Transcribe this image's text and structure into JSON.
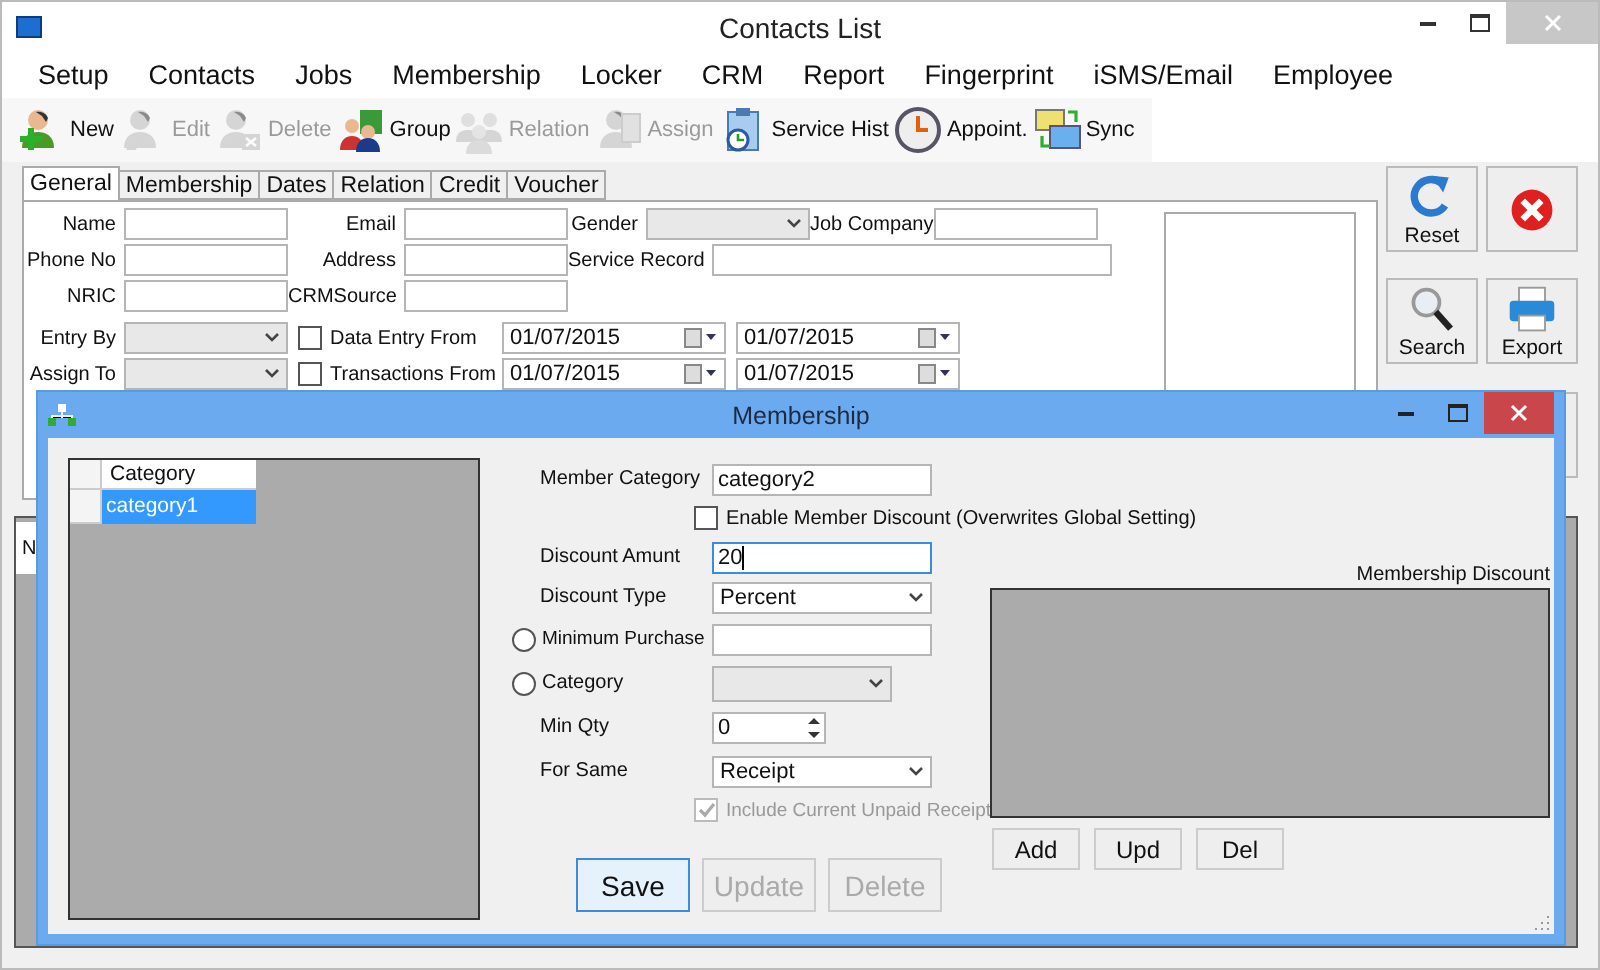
{
  "window": {
    "title": "Contacts List"
  },
  "menu": [
    "Setup",
    "Contacts",
    "Jobs",
    "Membership",
    "Locker",
    "CRM",
    "Report",
    "Fingerprint",
    "iSMS/Email",
    "Employee"
  ],
  "toolbar": [
    {
      "label": "New",
      "disabled": false
    },
    {
      "label": "Edit",
      "disabled": true
    },
    {
      "label": "Delete",
      "disabled": true
    },
    {
      "label": "Group",
      "disabled": false
    },
    {
      "label": "Relation",
      "disabled": true
    },
    {
      "label": "Assign",
      "disabled": true
    },
    {
      "label": "Service Hist",
      "disabled": false
    },
    {
      "label": "Appoint.",
      "disabled": false
    },
    {
      "label": "Sync",
      "disabled": false
    }
  ],
  "tabs": [
    {
      "label": "General",
      "selected": true
    },
    {
      "label": "Membership",
      "selected": false
    },
    {
      "label": "Dates",
      "selected": false
    },
    {
      "label": "Relation",
      "selected": false
    },
    {
      "label": "Credit",
      "selected": false
    },
    {
      "label": "Voucher",
      "selected": false
    }
  ],
  "form_rows": [
    [
      {
        "kind": "text",
        "label": "Name"
      },
      {
        "kind": "text",
        "label": "Email"
      },
      {
        "kind": "combo",
        "label": "Gender"
      },
      {
        "kind": "text",
        "label": "Job Company"
      }
    ],
    [
      {
        "kind": "text",
        "label": "Phone No"
      },
      {
        "kind": "text",
        "label": "Address"
      },
      {
        "kind": "wide",
        "label": "Service Record"
      }
    ],
    [
      {
        "kind": "text",
        "label": "NRIC"
      },
      {
        "kind": "text",
        "label": "CRMSource"
      }
    ],
    [
      {
        "kind": "combo",
        "label": "Entry By"
      },
      {
        "kind": "daterange",
        "label": "Data Entry From",
        "checked": false,
        "from": "01/07/2015",
        "to": "01/07/2015"
      }
    ],
    [
      {
        "kind": "combo",
        "label": "Assign To"
      },
      {
        "kind": "daterange",
        "label": "Transactions From",
        "checked": false,
        "from": "01/07/2015",
        "to": "01/07/2015"
      }
    ]
  ],
  "side_buttons": [
    {
      "kind": "labeled",
      "label": "Reset"
    },
    {
      "kind": "icon"
    },
    {
      "kind": "labeled",
      "label": "Search"
    },
    {
      "kind": "labeled",
      "label": "Export"
    },
    {
      "kind": "icon"
    }
  ],
  "lower_tabs": [
    "N"
  ],
  "dialog": {
    "title": "Membership",
    "category_grid": {
      "column": "Category",
      "rows": [
        {
          "cell": "category1",
          "selected": true
        }
      ]
    },
    "member_category": {
      "label": "Member Category",
      "value": "category2"
    },
    "enable_discount": {
      "label": "Enable Member Discount (Overwrites Global Setting)",
      "checked": false
    },
    "discount_amount": {
      "label": "Discount Amunt",
      "value": "20",
      "focused": true
    },
    "discount_type": {
      "label": "Discount Type",
      "value": "Percent"
    },
    "minimum_purchase": {
      "label": "Minimum Purchase",
      "selected": false
    },
    "category": {
      "label": "Category",
      "selected": false
    },
    "min_qty": {
      "label": "Min Qty",
      "value": "0"
    },
    "for_same": {
      "label": "For Same",
      "value": "Receipt"
    },
    "include_unpaid": {
      "label": "Include Current Unpaid Receipt",
      "checked": true,
      "disabled": true
    },
    "buttons": [
      {
        "label": "Save",
        "disabled": false,
        "default": true
      },
      {
        "label": "Update",
        "disabled": true,
        "default": false
      },
      {
        "label": "Delete",
        "disabled": true,
        "default": false
      }
    ],
    "discount_panel": {
      "title": "Membership Discount",
      "buttons": [
        "Add",
        "Upd",
        "Del"
      ]
    }
  }
}
